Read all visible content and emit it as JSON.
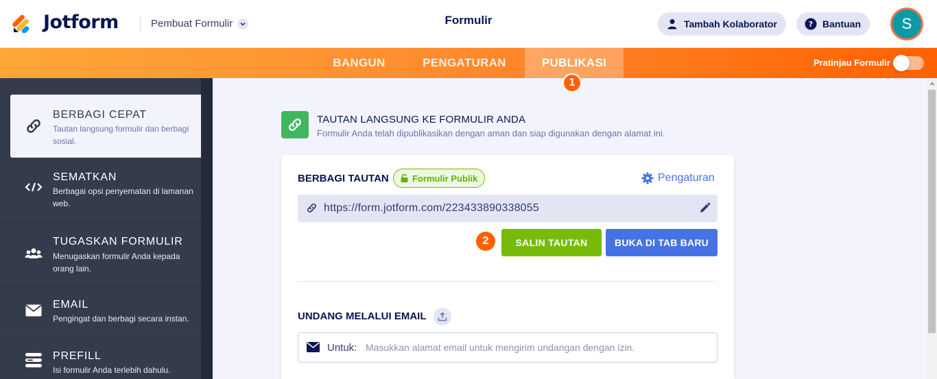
{
  "header": {
    "logo_text": "Jotform",
    "builder_label": "Pembuat Formulir",
    "page_title": "Formulir",
    "collaborator_button": "Tambah Kolaborator",
    "help_button": "Bantuan",
    "avatar_initial": "S"
  },
  "nav": {
    "tabs": [
      {
        "label": "BANGUN"
      },
      {
        "label": "PENGATURAN"
      },
      {
        "label": "PUBLIKASI"
      }
    ],
    "active_tab": "PUBLIKASI",
    "preview_label": "Pratinjau Formulir",
    "preview_enabled": false,
    "step_badge": "1"
  },
  "sidebar": {
    "items": [
      {
        "title": "BERBAGI CEPAT",
        "desc": "Tautan langsung formulir dan berbagi sosial.",
        "icon": "link-icon",
        "active": true
      },
      {
        "title": "SEMATKAN",
        "desc": "Berbagai opsi penyematan di lamanan web.",
        "icon": "code-icon",
        "active": false
      },
      {
        "title": "TUGASKAN FORMULIR",
        "desc": "Menugaskan formulir Anda kepada orang lain.",
        "icon": "users-icon",
        "active": false
      },
      {
        "title": "EMAIL",
        "desc": "Pengingat dan berbagi secara instan.",
        "icon": "envelope-icon",
        "active": false
      },
      {
        "title": "PREFILL",
        "desc": "Isi formulir Anda terlebih dahulu.",
        "icon": "prefill-icon",
        "active": false
      }
    ]
  },
  "main": {
    "section_title": "TAUTAN LANGSUNG KE FORMULIR ANDA",
    "section_subtitle": "Formulir Anda telah dipublikasikan dengan aman dan siap digunakan dengan alamat ini.",
    "share": {
      "label": "BERBAGI TAUTAN",
      "public_badge": "Formulir Publik",
      "settings_link": "Pengaturan",
      "url": "https://form.jotform.com/223433890338055",
      "step_badge": "2",
      "copy_button": "SALIN TAUTAN",
      "open_button": "BUKA DI TAB BARU"
    },
    "invite": {
      "label": "UNDANG MELALUI EMAIL",
      "to_label": "Untuk:",
      "placeholder": "Masukkan alamat email untuk mengirim undangan dengan izin."
    }
  },
  "colors": {
    "accent_orange": "#ff6100",
    "green": "#78bb07",
    "blue": "#4573e3",
    "navy": "#0a1551",
    "sidebar_bg": "#343c4c"
  }
}
